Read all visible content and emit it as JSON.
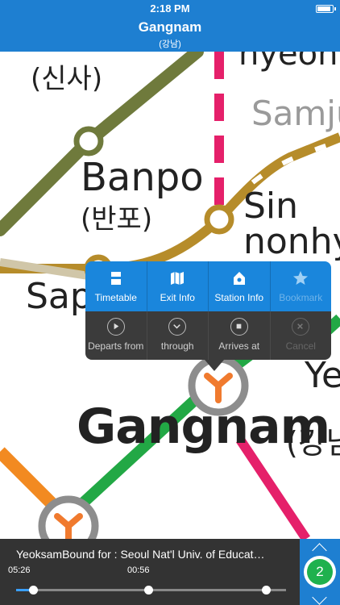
{
  "status_bar": {
    "time": "2:18 PM",
    "battery_level": 0.95
  },
  "header": {
    "title": "Gangnam",
    "subtitle": "(강남)"
  },
  "map": {
    "labels": {
      "sinsa_kr": "(신사)",
      "nonhyeon_partial": "hyeon",
      "samjun_partial": "Samju",
      "banpo": "Banpo",
      "banpo_kr": "(반포)",
      "sin": "Sin",
      "nonhy": "nonhy",
      "sap_partial": "Sap",
      "ye_partial": "Ye",
      "gangnam": "Gangnam",
      "gangnam_kr": "(강남"
    },
    "line_colors": {
      "olive": "#6f7a3c",
      "gold": "#b68c2a",
      "magenta": "#e5206a",
      "green": "#22a845",
      "orange": "#f28a21",
      "gray": "#8d8d8d"
    }
  },
  "popup": {
    "top_buttons": [
      {
        "label": "Timetable",
        "icon": "timetable-icon"
      },
      {
        "label": "Exit Info",
        "icon": "map-icon"
      },
      {
        "label": "Station Info",
        "icon": "house-icon"
      },
      {
        "label": "Bookmark",
        "icon": "star-icon"
      }
    ],
    "bottom_buttons": [
      {
        "label": "Departs from",
        "icon": "play-icon"
      },
      {
        "label": "through",
        "icon": "chevron-down-icon"
      },
      {
        "label": "Arrives at",
        "icon": "stop-icon"
      },
      {
        "label": "Cancel",
        "icon": "close-icon"
      }
    ]
  },
  "bottom_bar": {
    "route_text": "YeoksamBound for : Seoul Nat'l Univ. of Educat…",
    "time_start": "05:26",
    "time_mid": "00:56",
    "progress": 0.05,
    "badge_number": "2"
  }
}
